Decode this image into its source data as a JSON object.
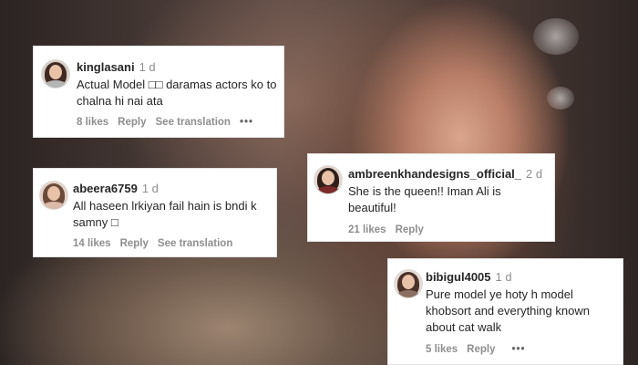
{
  "comments": [
    {
      "username": "kinglasani",
      "time": "1 d",
      "text": "Actual Model □□ daramas actors ko to chalna hi nai ata",
      "likes": "8 likes",
      "reply": "Reply",
      "translation": "See translation",
      "more": "•••"
    },
    {
      "username": "abeera6759",
      "time": "1 d",
      "text": "All haseen lrkiyan fail hain is bndi k samny □",
      "likes": "14 likes",
      "reply": "Reply",
      "translation": "See translation"
    },
    {
      "username": "ambreenkhandesigns_official_",
      "time": "2 d",
      "text": "She is the queen!! Iman Ali is beautiful!",
      "likes": "21 likes",
      "reply": "Reply"
    },
    {
      "username": "bibigul4005",
      "time": "1 d",
      "text": "Pure model ye hoty h model khobsort and everything known about cat walk",
      "likes": "5 likes",
      "reply": "Reply",
      "more": "•••"
    }
  ]
}
